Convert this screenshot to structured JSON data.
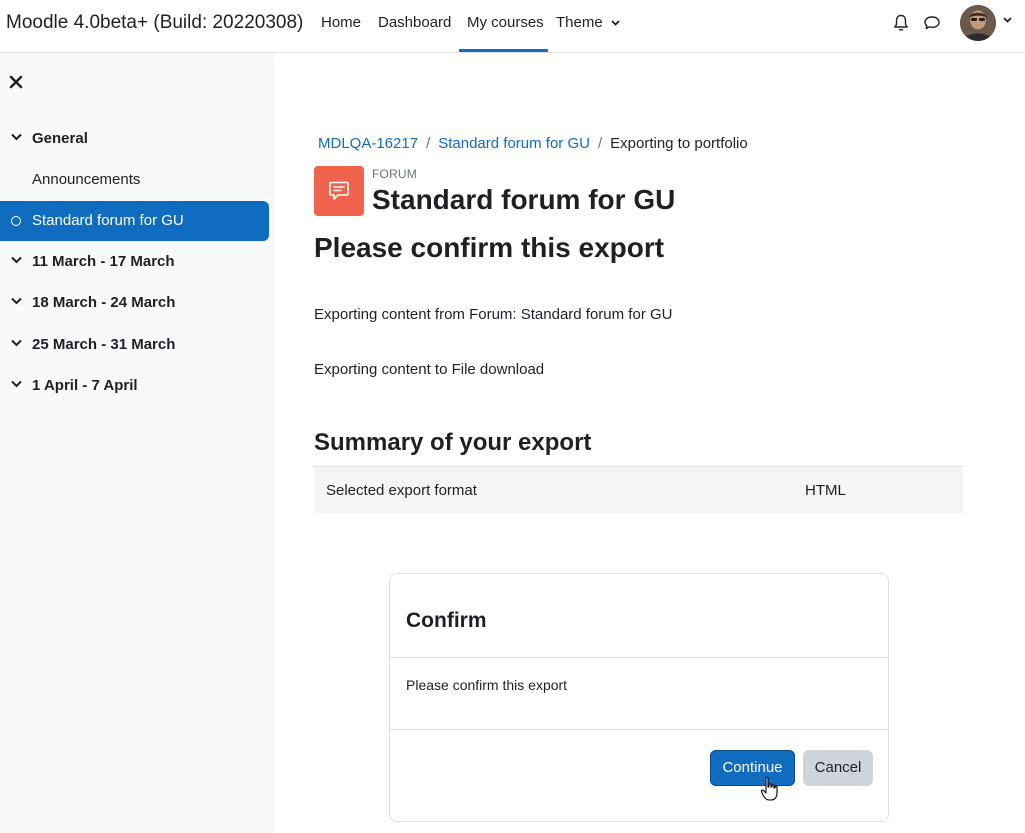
{
  "header": {
    "site_name": "Moodle 4.0beta+ (Build: 20220308)",
    "nav": [
      {
        "label": "Home"
      },
      {
        "label": "Dashboard"
      },
      {
        "label": "My courses",
        "active": true
      },
      {
        "label": "Theme",
        "has_dropdown": true
      }
    ],
    "icons": [
      "bell-icon",
      "chat-icon",
      "avatar",
      "chevron-down-icon"
    ]
  },
  "sidebar": {
    "close_icon": "close-icon",
    "items": [
      {
        "label": "General",
        "type": "section",
        "expanded": true
      },
      {
        "label": "Announcements",
        "type": "activity"
      },
      {
        "label": "Standard forum for GU",
        "type": "activity",
        "current": true
      },
      {
        "label": "11 March - 17 March",
        "type": "section"
      },
      {
        "label": "18 March - 24 March",
        "type": "section"
      },
      {
        "label": "25 March - 31 March",
        "type": "section"
      },
      {
        "label": "1 April - 7 April",
        "type": "section"
      }
    ]
  },
  "breadcrumb": {
    "items": [
      "MDLQA-16217",
      "Standard forum for GU",
      "Exporting to portfolio"
    ],
    "separator": "/"
  },
  "page": {
    "activity_type": "FORUM",
    "title": "Standard forum for GU",
    "heading": "Please confirm this export",
    "line1": "Exporting content from Forum: Standard forum for GU",
    "line2": "Exporting content to File download",
    "summary_heading": "Summary of your export",
    "summary": {
      "label": "Selected export format",
      "value": "HTML"
    }
  },
  "confirm": {
    "title": "Confirm",
    "message": "Please confirm this export",
    "continue_label": "Continue",
    "cancel_label": "Cancel"
  },
  "colors": {
    "primary": "#0f6cbf",
    "forum_icon": "#f0634d",
    "sidebar_bg": "#f8f9fa",
    "secondary_btn": "#ced4da"
  }
}
